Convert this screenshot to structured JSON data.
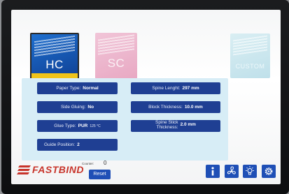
{
  "modes": {
    "hc": {
      "label": "HC"
    },
    "sc": {
      "label": "SC"
    },
    "custom": {
      "label": "CUSTOM"
    }
  },
  "fields": {
    "paper_type": {
      "label": "Paper Type:",
      "value": "Normal"
    },
    "side_gluing": {
      "label": "Side Gluing:",
      "value": "No"
    },
    "glue_type": {
      "label": "Glue Type:",
      "value": "PUR",
      "temp": "125 °C"
    },
    "guide_position": {
      "label": "Guide Position:",
      "value": "2"
    },
    "spine_length": {
      "label": "Spine Lenght:",
      "value": "297 mm"
    },
    "block_thickness": {
      "label": "Block Thickness:",
      "value": "10.0 mm"
    },
    "spine_stick_thickness": {
      "label_line1": "Spine Stick",
      "label_line2": "Thickness:",
      "value": "2.0 mm"
    }
  },
  "footer": {
    "logo_text": "FASTBIND",
    "counter_label": "Counter:",
    "counter_value": "0",
    "reset_label": "Reset"
  },
  "icons": [
    "info-icon",
    "fan-icon",
    "lamp-icon",
    "settings-icon"
  ],
  "colors": {
    "field_bg": "#1f3f93",
    "panel_bg": "#d7edf6",
    "button_blue": "#1f4fb6",
    "logo_red": "#c8342b",
    "hc_base": "#f0c419"
  }
}
